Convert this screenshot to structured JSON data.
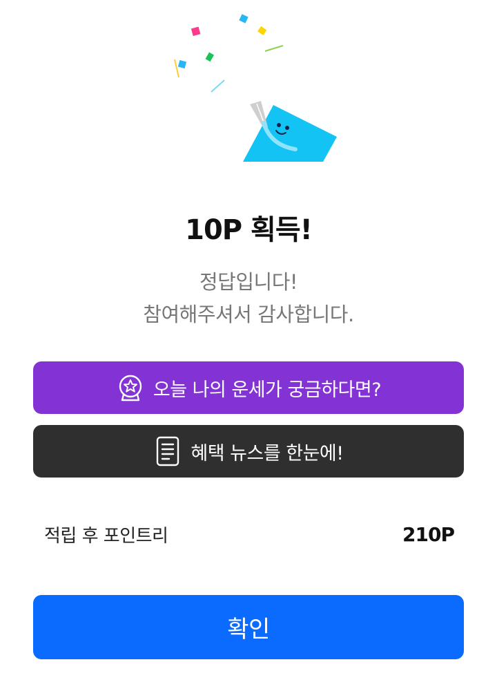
{
  "dialog": {
    "title": "10P 획득!",
    "message_line1": "정답입니다!",
    "message_line2": "참여해주셔서 감사합니다."
  },
  "promo_buttons": [
    {
      "label": "오늘 나의 운세가 궁금하다면?",
      "icon": "crystal-ball-icon",
      "color": "#8333d3"
    },
    {
      "label": "혜택 뉴스를 한눈에!",
      "icon": "document-icon",
      "color": "#2f2f2f"
    }
  ],
  "points": {
    "label": "적립 후 포인트리",
    "value": "210P"
  },
  "confirm_button": {
    "label": "확인",
    "color": "#0a6bfe"
  },
  "colors": {
    "mascot": "#12c3f3"
  },
  "illustration": "celebration-confetti-mascot"
}
